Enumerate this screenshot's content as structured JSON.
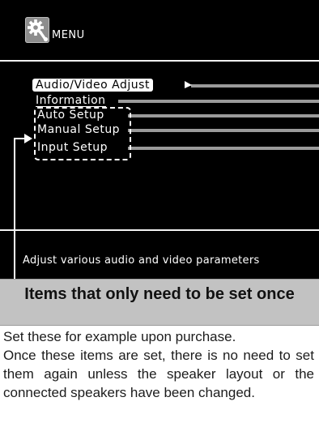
{
  "menu": {
    "icon": "gear-wrench-icon",
    "title": "MENU",
    "items": [
      {
        "label": "Audio/Video Adjust",
        "selected": true
      },
      {
        "label": "Information",
        "selected": false
      },
      {
        "label": "Auto Setup",
        "selected": false
      },
      {
        "label": "Manual Setup",
        "selected": false
      },
      {
        "label": "Input Setup",
        "selected": false
      }
    ],
    "description": "Adjust various audio and video parameters"
  },
  "callout": {
    "title": "Items that only need to be set once",
    "paragraphs": [
      "Set these for example upon purchase.",
      "Once these items are set, there is no need to set them again unless the speaker layout or the connected speakers have been changed."
    ]
  },
  "colors": {
    "screen_background": "#000000",
    "screen_text": "#ffffff",
    "banner_background": "#c2c2c2",
    "leader_lines": "#9a9a9a"
  }
}
